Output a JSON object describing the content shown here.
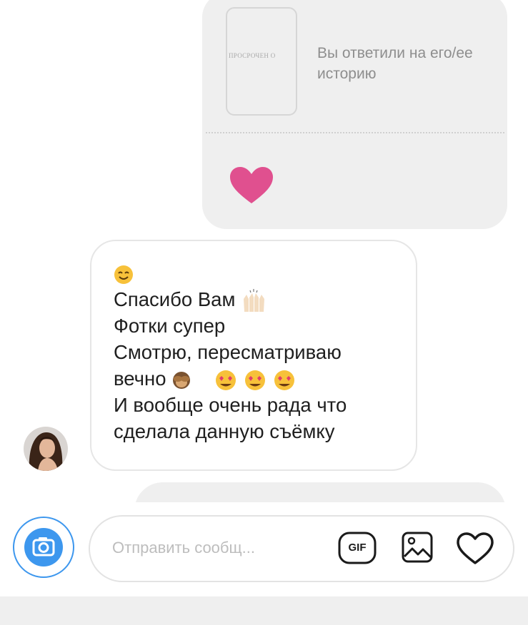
{
  "story_reply": {
    "expired_label": "ПРОСРОЧЕН О",
    "reply_text": "Вы ответили на его/ее историю",
    "reaction": "heart-icon"
  },
  "message": {
    "lines": [
      "",
      "Спасибо Вам",
      "Фотки супер",
      "Смотрю, пересматриваю",
      "вечно",
      "И вообще очень рада что",
      "сделала данную съёмку"
    ],
    "emojis": [
      "smiling-face-icon",
      "raising-hands-icon",
      "see-no-evil-monkey-icon",
      "heart-eyes-face-icon"
    ]
  },
  "composer": {
    "placeholder": "Отправить сообщ...",
    "gif_label": "GIF"
  },
  "colors": {
    "accent_blue": "#3d97ee",
    "bubble_gray": "#efefef",
    "heart_pink": "#e0508f"
  }
}
